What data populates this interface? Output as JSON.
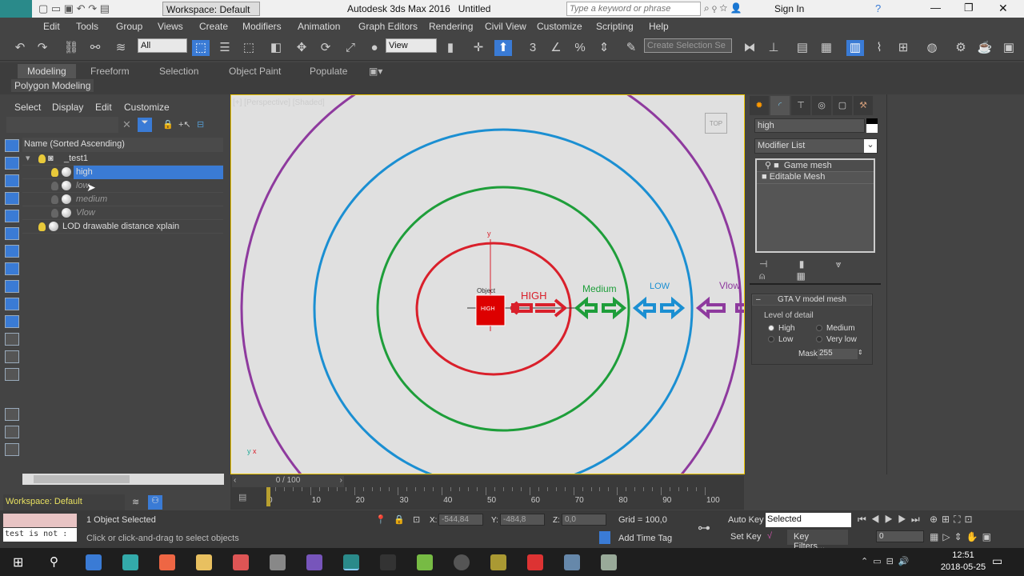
{
  "titlebar": {
    "workspace": "Workspace: Default",
    "title": "Autodesk 3ds Max 2016",
    "doc": "Untitled",
    "search_placeholder": "Type a keyword or phrase",
    "signin": "Sign In"
  },
  "menu": [
    "Edit",
    "Tools",
    "Group",
    "Views",
    "Create",
    "Modifiers",
    "Animation",
    "Graph Editors",
    "Rendering",
    "Civil View",
    "Customize",
    "Scripting",
    "Help"
  ],
  "toolbar": {
    "filter": "All",
    "refcoord": "View",
    "selset": "Create Selection Se"
  },
  "ribbon": {
    "tabs": [
      "Modeling",
      "Freeform",
      "Selection",
      "Object Paint",
      "Populate"
    ],
    "panel": "Polygon Modeling"
  },
  "explorer": {
    "menus": [
      "Select",
      "Display",
      "Edit",
      "Customize"
    ],
    "header": "Name (Sorted Ascending)",
    "items": [
      {
        "name": "_test1"
      },
      {
        "name": "high"
      },
      {
        "name": "low"
      },
      {
        "name": "medium"
      },
      {
        "name": "Vlow"
      },
      {
        "name": "LOD drawable distance xplain"
      }
    ]
  },
  "viewport": {
    "label": "[+] [Perspective] [Shaded]",
    "viewcube": "TOP",
    "texts": {
      "object": "Object",
      "high": "HIGH",
      "medium": "Medium",
      "low": "LOW",
      "vlow": "Vlow",
      "box": "HIGH"
    },
    "colors": {
      "high": "#d9202b",
      "medium": "#1e9e3a",
      "low": "#1b8fd2",
      "vlow": "#8e3a9e"
    }
  },
  "command": {
    "object_name": "high",
    "modifier_list": "Modifier List",
    "stack": [
      "Game mesh",
      "Editable Mesh"
    ],
    "rollout": "GTA V model mesh",
    "lod_label": "Level of detail",
    "options": [
      "High",
      "Medium",
      "Low",
      "Very low"
    ],
    "selected": "High",
    "mask_label": "Mask",
    "mask": "255"
  },
  "timeline": {
    "frame": "0 / 100",
    "ticks": [
      "0",
      "10",
      "20",
      "30",
      "40",
      "50",
      "60",
      "70",
      "80",
      "90",
      "100"
    ]
  },
  "status": {
    "workspace": "Workspace: Default",
    "script": "test is not :",
    "selected": "1 Object Selected",
    "prompt": "Click or click-and-drag to select objects",
    "x_label": "X:",
    "x": "-544,84",
    "y_label": "Y:",
    "y": "-484,8",
    "z_label": "Z:",
    "z": "0,0",
    "grid": "Grid = 100,0",
    "add_time_tag": "Add Time Tag",
    "auto_key": "Auto Key",
    "set_key": "Set Key",
    "key_mode": "Selected",
    "key_filters": "Key Filters...",
    "frame": "0"
  },
  "taskbar": {
    "time": "12:51",
    "date": "2018-05-25"
  }
}
